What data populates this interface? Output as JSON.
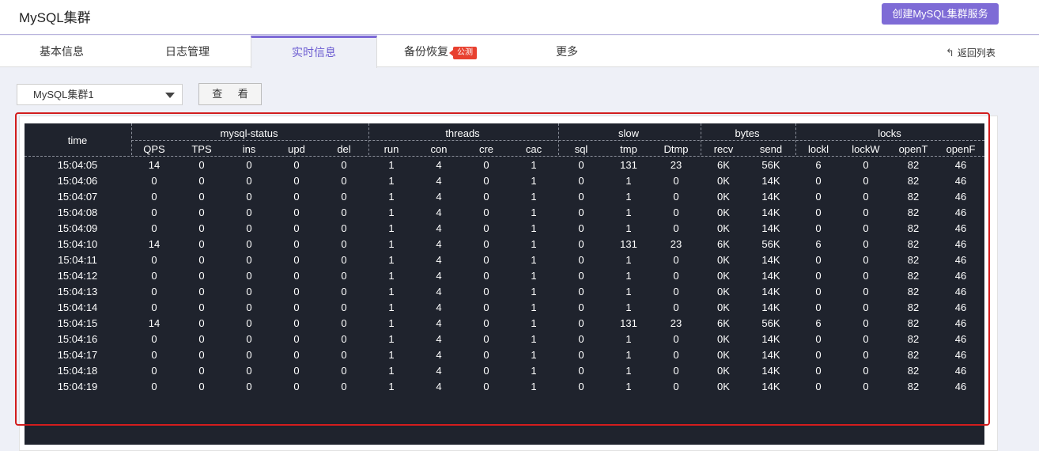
{
  "header": {
    "title": "MySQL集群",
    "create_button": "创建MySQL集群服务"
  },
  "tabs": [
    {
      "label": "基本信息",
      "active": false
    },
    {
      "label": "日志管理",
      "active": false
    },
    {
      "label": "实时信息",
      "active": true
    },
    {
      "label": "备份恢复",
      "active": false,
      "badge": "公测"
    },
    {
      "label": "更多",
      "active": false
    }
  ],
  "back_link": "返回列表",
  "toolbar": {
    "cluster_select": "MySQL集群1",
    "view_button": "查 看"
  },
  "colors": {
    "accent": "#7e6bd6",
    "terminal_bg": "#1f232d",
    "highlight": "#d21d1d",
    "badge": "#e8402f"
  },
  "table": {
    "time_header": "time",
    "groups": [
      {
        "label": "mysql-status",
        "columns": [
          "QPS",
          "TPS",
          "ins",
          "upd",
          "del"
        ]
      },
      {
        "label": "threads",
        "columns": [
          "run",
          "con",
          "cre",
          "cac"
        ]
      },
      {
        "label": "slow",
        "columns": [
          "sql",
          "tmp",
          "Dtmp"
        ]
      },
      {
        "label": "bytes",
        "columns": [
          "recv",
          "send"
        ]
      },
      {
        "label": "locks",
        "columns": [
          "lockl",
          "lockW",
          "openT",
          "openF"
        ]
      }
    ],
    "rows": [
      [
        "15:04:05",
        "14",
        "0",
        "0",
        "0",
        "0",
        "1",
        "4",
        "0",
        "1",
        "0",
        "131",
        "23",
        "6K",
        "56K",
        "6",
        "0",
        "82",
        "46"
      ],
      [
        "15:04:06",
        "0",
        "0",
        "0",
        "0",
        "0",
        "1",
        "4",
        "0",
        "1",
        "0",
        "1",
        "0",
        "0K",
        "14K",
        "0",
        "0",
        "82",
        "46"
      ],
      [
        "15:04:07",
        "0",
        "0",
        "0",
        "0",
        "0",
        "1",
        "4",
        "0",
        "1",
        "0",
        "1",
        "0",
        "0K",
        "14K",
        "0",
        "0",
        "82",
        "46"
      ],
      [
        "15:04:08",
        "0",
        "0",
        "0",
        "0",
        "0",
        "1",
        "4",
        "0",
        "1",
        "0",
        "1",
        "0",
        "0K",
        "14K",
        "0",
        "0",
        "82",
        "46"
      ],
      [
        "15:04:09",
        "0",
        "0",
        "0",
        "0",
        "0",
        "1",
        "4",
        "0",
        "1",
        "0",
        "1",
        "0",
        "0K",
        "14K",
        "0",
        "0",
        "82",
        "46"
      ],
      [
        "15:04:10",
        "14",
        "0",
        "0",
        "0",
        "0",
        "1",
        "4",
        "0",
        "1",
        "0",
        "131",
        "23",
        "6K",
        "56K",
        "6",
        "0",
        "82",
        "46"
      ],
      [
        "15:04:11",
        "0",
        "0",
        "0",
        "0",
        "0",
        "1",
        "4",
        "0",
        "1",
        "0",
        "1",
        "0",
        "0K",
        "14K",
        "0",
        "0",
        "82",
        "46"
      ],
      [
        "15:04:12",
        "0",
        "0",
        "0",
        "0",
        "0",
        "1",
        "4",
        "0",
        "1",
        "0",
        "1",
        "0",
        "0K",
        "14K",
        "0",
        "0",
        "82",
        "46"
      ],
      [
        "15:04:13",
        "0",
        "0",
        "0",
        "0",
        "0",
        "1",
        "4",
        "0",
        "1",
        "0",
        "1",
        "0",
        "0K",
        "14K",
        "0",
        "0",
        "82",
        "46"
      ],
      [
        "15:04:14",
        "0",
        "0",
        "0",
        "0",
        "0",
        "1",
        "4",
        "0",
        "1",
        "0",
        "1",
        "0",
        "0K",
        "14K",
        "0",
        "0",
        "82",
        "46"
      ],
      [
        "15:04:15",
        "14",
        "0",
        "0",
        "0",
        "0",
        "1",
        "4",
        "0",
        "1",
        "0",
        "131",
        "23",
        "6K",
        "56K",
        "6",
        "0",
        "82",
        "46"
      ],
      [
        "15:04:16",
        "0",
        "0",
        "0",
        "0",
        "0",
        "1",
        "4",
        "0",
        "1",
        "0",
        "1",
        "0",
        "0K",
        "14K",
        "0",
        "0",
        "82",
        "46"
      ],
      [
        "15:04:17",
        "0",
        "0",
        "0",
        "0",
        "0",
        "1",
        "4",
        "0",
        "1",
        "0",
        "1",
        "0",
        "0K",
        "14K",
        "0",
        "0",
        "82",
        "46"
      ],
      [
        "15:04:18",
        "0",
        "0",
        "0",
        "0",
        "0",
        "1",
        "4",
        "0",
        "1",
        "0",
        "1",
        "0",
        "0K",
        "14K",
        "0",
        "0",
        "82",
        "46"
      ],
      [
        "15:04:19",
        "0",
        "0",
        "0",
        "0",
        "0",
        "1",
        "4",
        "0",
        "1",
        "0",
        "1",
        "0",
        "0K",
        "14K",
        "0",
        "0",
        "82",
        "46"
      ]
    ]
  }
}
